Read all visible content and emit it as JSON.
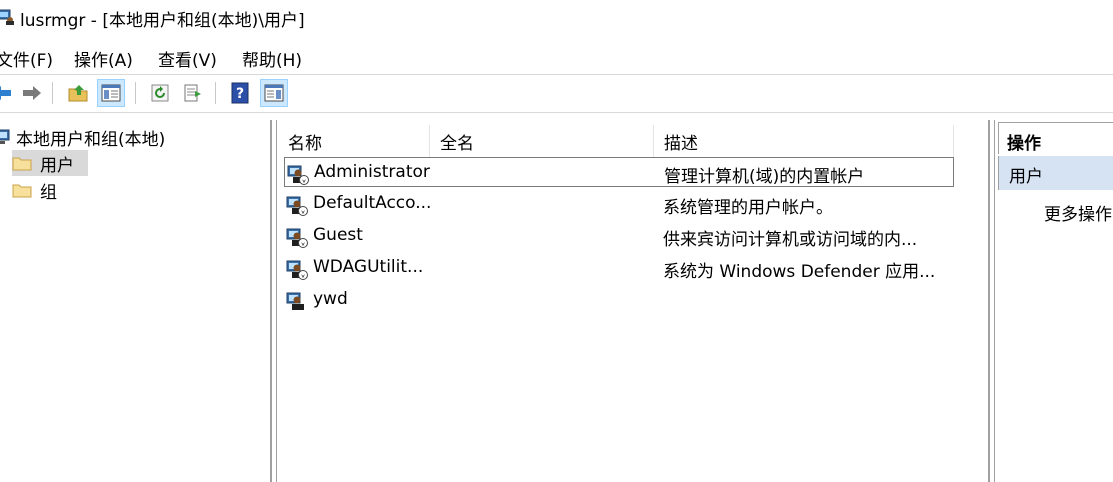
{
  "window": {
    "title": "lusrmgr - [本地用户和组(本地)\\用户]"
  },
  "menu": {
    "items": [
      "文件(F)",
      "操作(A)",
      "查看(V)",
      "帮助(H)"
    ]
  },
  "toolbar": {
    "buttons": [
      "back-icon",
      "forward-icon",
      "up-folder-icon",
      "show-hide-tree-icon",
      "refresh-icon",
      "export-list-icon",
      "help-icon",
      "show-hide-action-pane-icon"
    ]
  },
  "tree": {
    "root": "本地用户和组(本地)",
    "children": [
      "用户",
      "组"
    ],
    "selected": "用户"
  },
  "list": {
    "columns": [
      "名称",
      "全名",
      "描述"
    ],
    "rows": [
      {
        "name": "Administrator",
        "fullname": "",
        "description": "管理计算机(域)的内置帐户"
      },
      {
        "name": "DefaultAcco...",
        "fullname": "",
        "description": "系统管理的用户帐户。"
      },
      {
        "name": "Guest",
        "fullname": "",
        "description": "供来宾访问计算机或访问域的内..."
      },
      {
        "name": "WDAGUtilit...",
        "fullname": "",
        "description": "系统为 Windows Defender 应用..."
      },
      {
        "name": "ywd",
        "fullname": "",
        "description": ""
      }
    ]
  },
  "actions": {
    "header": "操作",
    "section": "用户",
    "items": [
      "更多操作"
    ]
  },
  "colors": {
    "selection": "#d9d9d9",
    "action_section": "#d5e3f3",
    "toolbar_active": "#cce8ff"
  }
}
